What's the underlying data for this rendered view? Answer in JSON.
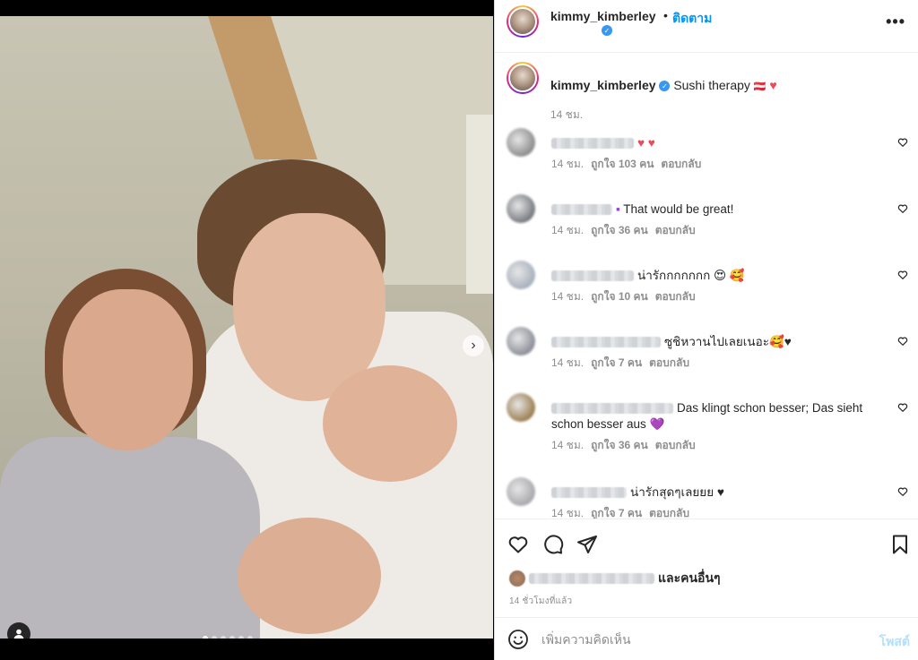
{
  "header": {
    "username": "kimmy_kimberley",
    "separator": "•",
    "follow_label": "ติดตาม",
    "more_label": "•••",
    "verified_glyph": "✓"
  },
  "post": {
    "caption_username": "kimmy_kimberley",
    "caption_text": "Sushi therapy ",
    "caption_emoji_1": "🇦🇹",
    "caption_emoji_2": "♥",
    "caption_time": "14 ชม.",
    "next_arrow": "›",
    "carousel_dots": 6,
    "carousel_active": 0
  },
  "comments": [
    {
      "text": "",
      "emoji": "♥ ♥",
      "time": "14 ชม.",
      "likes": "ถูกใจ 103 คน",
      "reply": "ตอบกลับ",
      "avatar_color": "#8d8d8d"
    },
    {
      "text": "That would be great!",
      "emoji": "▪",
      "time": "14 ชม.",
      "likes": "ถูกใจ 36 คน",
      "reply": "ตอบกลับ",
      "avatar_color": "#777a80"
    },
    {
      "text": "น่ารักกกกกกก 😍 🥰",
      "emoji": "",
      "time": "14 ชม.",
      "likes": "ถูกใจ 10 คน",
      "reply": "ตอบกลับ",
      "avatar_color": "#a8b0bd"
    },
    {
      "text": "ซูชิหวานไปเลยเนอะ🥰♥",
      "emoji": "",
      "time": "14 ชม.",
      "likes": "ถูกใจ 7 คน",
      "reply": "ตอบกลับ",
      "avatar_color": "#8c8f99"
    },
    {
      "text": "Das klingt schon besser; Das sieht schon besser aus 💜",
      "emoji": "",
      "time": "14 ชม.",
      "likes": "ถูกใจ 36 คน",
      "reply": "ตอบกลับ",
      "avatar_color": "#9c7f52"
    },
    {
      "text": "น่ารักสุดๆเลยยย ♥",
      "emoji": "",
      "time": "14 ชม.",
      "likes": "ถูกใจ 7 คน",
      "reply": "ตอบกลับ",
      "avatar_color": "#a9a9ad"
    }
  ],
  "actions": {
    "and_others": "และคนอื่นๆ",
    "time_ago": "14 ชั่วโมงที่แล้ว"
  },
  "composer": {
    "placeholder": "เพิ่มความคิดเห็น",
    "post_label": "โพสต์"
  },
  "colors": {
    "accent": "#0095f6",
    "heart": "#ed4956",
    "muted": "#8e8e8e"
  }
}
